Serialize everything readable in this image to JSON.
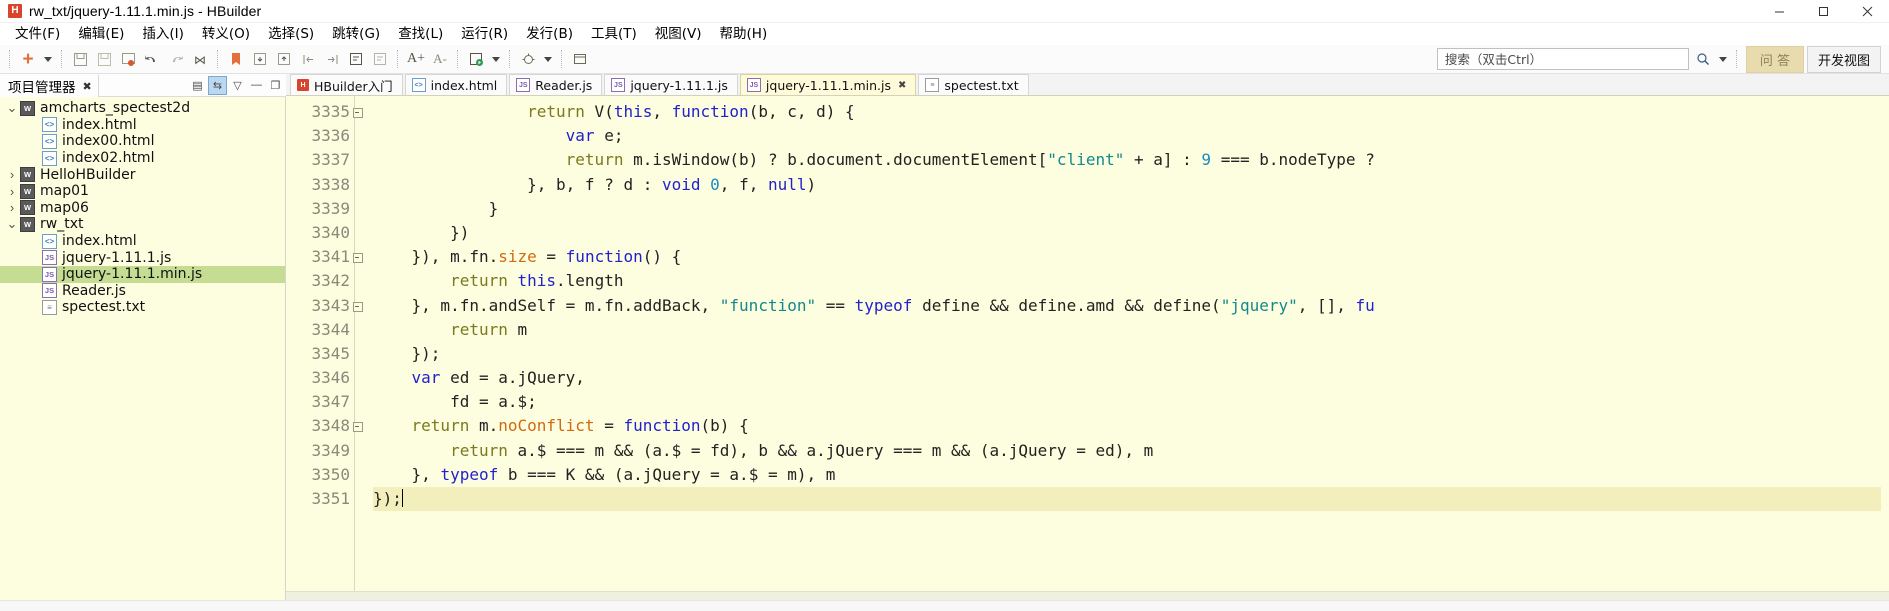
{
  "window": {
    "title": "rw_txt/jquery-1.11.1.min.js  -  HBuilder",
    "app_icon": "hbuilder-logo-icon",
    "minimize_label": "–",
    "maximize_label": "❐",
    "close_label": "✕"
  },
  "menu": {
    "items": [
      {
        "label": "文件(F)"
      },
      {
        "label": "编辑(E)"
      },
      {
        "label": "插入(I)"
      },
      {
        "label": "转义(O)"
      },
      {
        "label": "选择(S)"
      },
      {
        "label": "跳转(G)"
      },
      {
        "label": "查找(L)"
      },
      {
        "label": "运行(R)"
      },
      {
        "label": "发行(B)"
      },
      {
        "label": "工具(T)"
      },
      {
        "label": "视图(V)"
      },
      {
        "label": "帮助(H)"
      }
    ]
  },
  "toolbar": {
    "new_label": "+",
    "icons": [
      "new-file-icon",
      "new-dropdown-caret-icon",
      "save-icon",
      "save-all-icon",
      "save-as-browser-icon",
      "undo-icon",
      "redo-icon",
      "format-code-icon",
      "bookmark-icon",
      "indent-right-icon",
      "indent-left-icon",
      "jump-prev-icon",
      "jump-next-icon",
      "comment-icon",
      "uncomment-icon",
      "font-increase-icon",
      "font-decrease-icon",
      "run-browser-icon",
      "run-dropdown-caret-icon",
      "debug-icon",
      "debug-dropdown-caret-icon",
      "preview-icon"
    ],
    "font_increase_label": "A+",
    "font_decrease_label": "A-",
    "search": {
      "placeholder": "搜索（双击Ctrl）",
      "value": "",
      "icon": "search-icon",
      "dropdown_icon": "chevron-down-icon"
    },
    "qa_button_label": "问 答",
    "devview_button_label": "开发视图"
  },
  "sidebar": {
    "panel_title": "项目管理器",
    "close_label": "✖",
    "header_buttons": [
      {
        "name": "collapse-all-icon",
        "glyph": "▤",
        "active": false
      },
      {
        "name": "link-with-editor-icon",
        "glyph": "⇆",
        "active": true
      },
      {
        "name": "view-menu-icon",
        "glyph": "▽",
        "active": false
      },
      {
        "name": "minimize-panel-icon",
        "glyph": "—",
        "active": false
      },
      {
        "name": "maximize-panel-icon",
        "glyph": "❐",
        "active": false
      }
    ],
    "tree": [
      {
        "label": "amcharts_spectest2d",
        "depth": 0,
        "type": "project",
        "twisty": "expanded",
        "selected": false
      },
      {
        "label": "index.html",
        "depth": 1,
        "type": "html",
        "twisty": "none",
        "selected": false
      },
      {
        "label": "index00.html",
        "depth": 1,
        "type": "html",
        "twisty": "none",
        "selected": false
      },
      {
        "label": "index02.html",
        "depth": 1,
        "type": "html",
        "twisty": "none",
        "selected": false
      },
      {
        "label": "HelloHBuilder",
        "depth": 0,
        "type": "project",
        "twisty": "collapsed",
        "selected": false
      },
      {
        "label": "map01",
        "depth": 0,
        "type": "project",
        "twisty": "collapsed",
        "selected": false
      },
      {
        "label": "map06",
        "depth": 0,
        "type": "project",
        "twisty": "collapsed",
        "selected": false
      },
      {
        "label": "rw_txt",
        "depth": 0,
        "type": "project",
        "twisty": "expanded",
        "selected": false
      },
      {
        "label": "index.html",
        "depth": 1,
        "type": "html",
        "twisty": "none",
        "selected": false
      },
      {
        "label": "jquery-1.11.1.js",
        "depth": 1,
        "type": "js",
        "twisty": "none",
        "selected": false
      },
      {
        "label": "jquery-1.11.1.min.js",
        "depth": 1,
        "type": "js",
        "twisty": "none",
        "selected": true
      },
      {
        "label": "Reader.js",
        "depth": 1,
        "type": "js",
        "twisty": "none",
        "selected": false
      },
      {
        "label": "spectest.txt",
        "depth": 1,
        "type": "txt",
        "twisty": "none",
        "selected": false
      }
    ]
  },
  "editor": {
    "tabs": [
      {
        "label": "HBuilder入门",
        "type": "hb",
        "active": false,
        "closable": false
      },
      {
        "label": "index.html",
        "type": "html",
        "active": false,
        "closable": false
      },
      {
        "label": "Reader.js",
        "type": "js",
        "active": false,
        "closable": false
      },
      {
        "label": "jquery-1.11.1.js",
        "type": "js",
        "active": false,
        "closable": false
      },
      {
        "label": "jquery-1.11.1.min.js",
        "type": "js",
        "active": true,
        "closable": true,
        "close_label": "✖"
      },
      {
        "label": "spectest.txt",
        "type": "txt",
        "active": false,
        "closable": false
      }
    ],
    "first_line_number": 3335,
    "cursor_line": 3351,
    "lines": [
      {
        "n": 3335,
        "fold": true,
        "html": "                <span class='kw'>return</span> V(<span class='kwb'>this</span>, <span class='kwb'>function</span>(b, c, d) {"
      },
      {
        "n": 3336,
        "fold": false,
        "html": "                    <span class='kwb'>var</span> e;"
      },
      {
        "n": 3337,
        "fold": false,
        "html": "                    <span class='kw'>return</span> m.isWindow(b) ? b.document.documentElement[<span class='str'>\"client\"</span> + a] : <span class='num'>9</span> === b.nodeType ?"
      },
      {
        "n": 3338,
        "fold": false,
        "html": "                }, b, f ? d : <span class='kwb'>void</span> <span class='num'>0</span>, f, <span class='kwb'>null</span>)"
      },
      {
        "n": 3339,
        "fold": false,
        "html": "            }"
      },
      {
        "n": 3340,
        "fold": false,
        "html": "        })"
      },
      {
        "n": 3341,
        "fold": true,
        "html": "    }), m.fn.<span class='fn'>size</span> = <span class='kwb'>function</span>() {"
      },
      {
        "n": 3342,
        "fold": false,
        "html": "        <span class='kw'>return</span> <span class='kwb'>this</span>.length"
      },
      {
        "n": 3343,
        "fold": true,
        "html": "    }, m.fn.andSelf = m.fn.addBack, <span class='str'>\"function\"</span> == <span class='kwb'>typeof</span> define &amp;&amp; define.amd &amp;&amp; define(<span class='str'>\"jquery\"</span>, [], <span class='kwb'>fu</span>"
      },
      {
        "n": 3344,
        "fold": false,
        "html": "        <span class='kw'>return</span> m"
      },
      {
        "n": 3345,
        "fold": false,
        "html": "    });"
      },
      {
        "n": 3346,
        "fold": false,
        "html": "    <span class='kwb'>var</span> ed = a.jQuery,"
      },
      {
        "n": 3347,
        "fold": false,
        "html": "        fd = a.$;"
      },
      {
        "n": 3348,
        "fold": true,
        "html": "    <span class='kw'>return</span> m.<span class='fn'>noConflict</span> = <span class='kwb'>function</span>(b) {"
      },
      {
        "n": 3349,
        "fold": false,
        "html": "        <span class='kw'>return</span> a.$ === m &amp;&amp; (a.$ = fd), b &amp;&amp; a.jQuery === m &amp;&amp; (a.jQuery = ed), m"
      },
      {
        "n": 3350,
        "fold": false,
        "html": "    }, <span class='kwb'>typeof</span> b === K &amp;&amp; (a.jQuery = a.$ = m), m"
      },
      {
        "n": 3351,
        "fold": false,
        "html": "});",
        "current": true
      }
    ]
  }
}
